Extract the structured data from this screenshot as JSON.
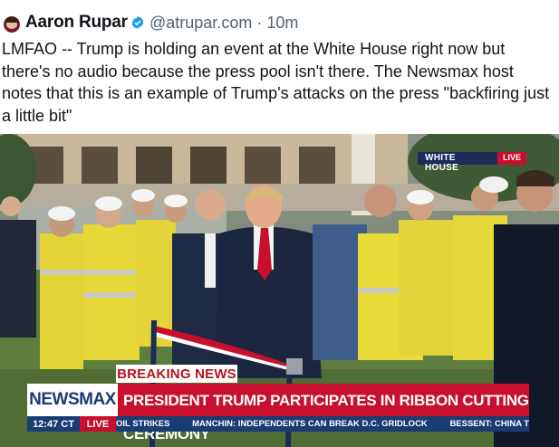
{
  "tweet": {
    "author_name": "Aaron Rupar",
    "handle_time": "@atrupar.com · 10m",
    "text": "LMFAO -- Trump is holding an event at the White House right now but there's no audio because the press pool isn't there. The Newsmax host notes that this is an example of Trump's attacks on the press \"backfiring just a little bit\"",
    "verified_color": "#1d9bf0"
  },
  "media": {
    "network_bug": "WHITE HOUSE",
    "network_live": "LIVE",
    "breaking_label": "BREAKING NEWS",
    "channel_logo": "NEWSMAX",
    "headline": "PRESIDENT TRUMP PARTICIPATES IN RIBBON CUTTING CEREMONY",
    "clock": "12:47 CT",
    "live_label": "LIVE",
    "ticker": [
      "OIL STRIKES",
      "MANCHIN: INDEPENDENTS CAN BREAK D.C. GRIDLOCK",
      "BESSENT: CHINA T"
    ]
  }
}
